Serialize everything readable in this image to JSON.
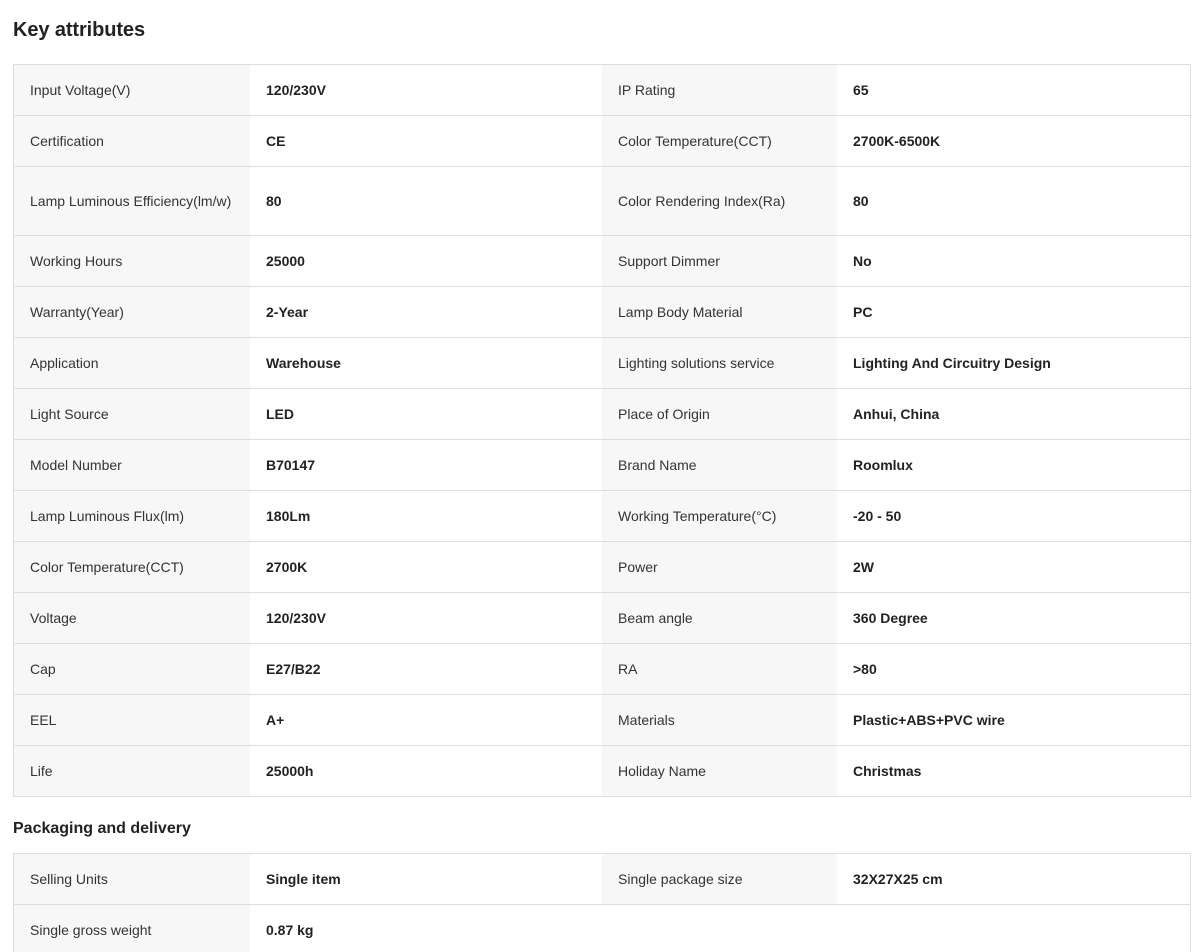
{
  "key_attributes": {
    "title": "Key attributes",
    "rows": [
      {
        "l1": "Input Voltage(V)",
        "v1": "120/230V",
        "l2": "IP Rating",
        "v2": "65"
      },
      {
        "l1": "Certification",
        "v1": "CE",
        "l2": "Color Temperature(CCT)",
        "v2": "2700K-6500K"
      },
      {
        "l1": "Lamp Luminous Efficiency(lm/w)",
        "v1": "80",
        "l2": "Color Rendering Index(Ra)",
        "v2": "80"
      },
      {
        "l1": "Working Hours",
        "v1": "25000",
        "l2": "Support Dimmer",
        "v2": "No"
      },
      {
        "l1": "Warranty(Year)",
        "v1": "2-Year",
        "l2": "Lamp Body Material",
        "v2": "PC"
      },
      {
        "l1": "Application",
        "v1": "Warehouse",
        "l2": "Lighting solutions service",
        "v2": "Lighting And Circuitry Design"
      },
      {
        "l1": "Light Source",
        "v1": "LED",
        "l2": "Place of Origin",
        "v2": "Anhui, China"
      },
      {
        "l1": "Model Number",
        "v1": "B70147",
        "l2": "Brand Name",
        "v2": "Roomlux"
      },
      {
        "l1": "Lamp Luminous Flux(lm)",
        "v1": "180Lm",
        "l2": "Working Temperature(°C)",
        "v2": "-20 - 50"
      },
      {
        "l1": "Color Temperature(CCT)",
        "v1": "2700K",
        "l2": "Power",
        "v2": "2W"
      },
      {
        "l1": "Voltage",
        "v1": "120/230V",
        "l2": "Beam angle",
        "v2": "360 Degree"
      },
      {
        "l1": "Cap",
        "v1": "E27/B22",
        "l2": "RA",
        "v2": ">80"
      },
      {
        "l1": "EEL",
        "v1": "A+",
        "l2": "Materials",
        "v2": "Plastic+ABS+PVC wire"
      },
      {
        "l1": "Life",
        "v1": "25000h",
        "l2": "Holiday Name",
        "v2": "Christmas"
      }
    ]
  },
  "packaging": {
    "title": "Packaging and delivery",
    "rows": [
      {
        "l1": "Selling Units",
        "v1": "Single item",
        "l2": "Single package size",
        "v2": "32X27X25 cm"
      },
      {
        "l1": "Single gross weight",
        "v1": "0.87 kg",
        "l2": "",
        "v2": ""
      }
    ]
  }
}
